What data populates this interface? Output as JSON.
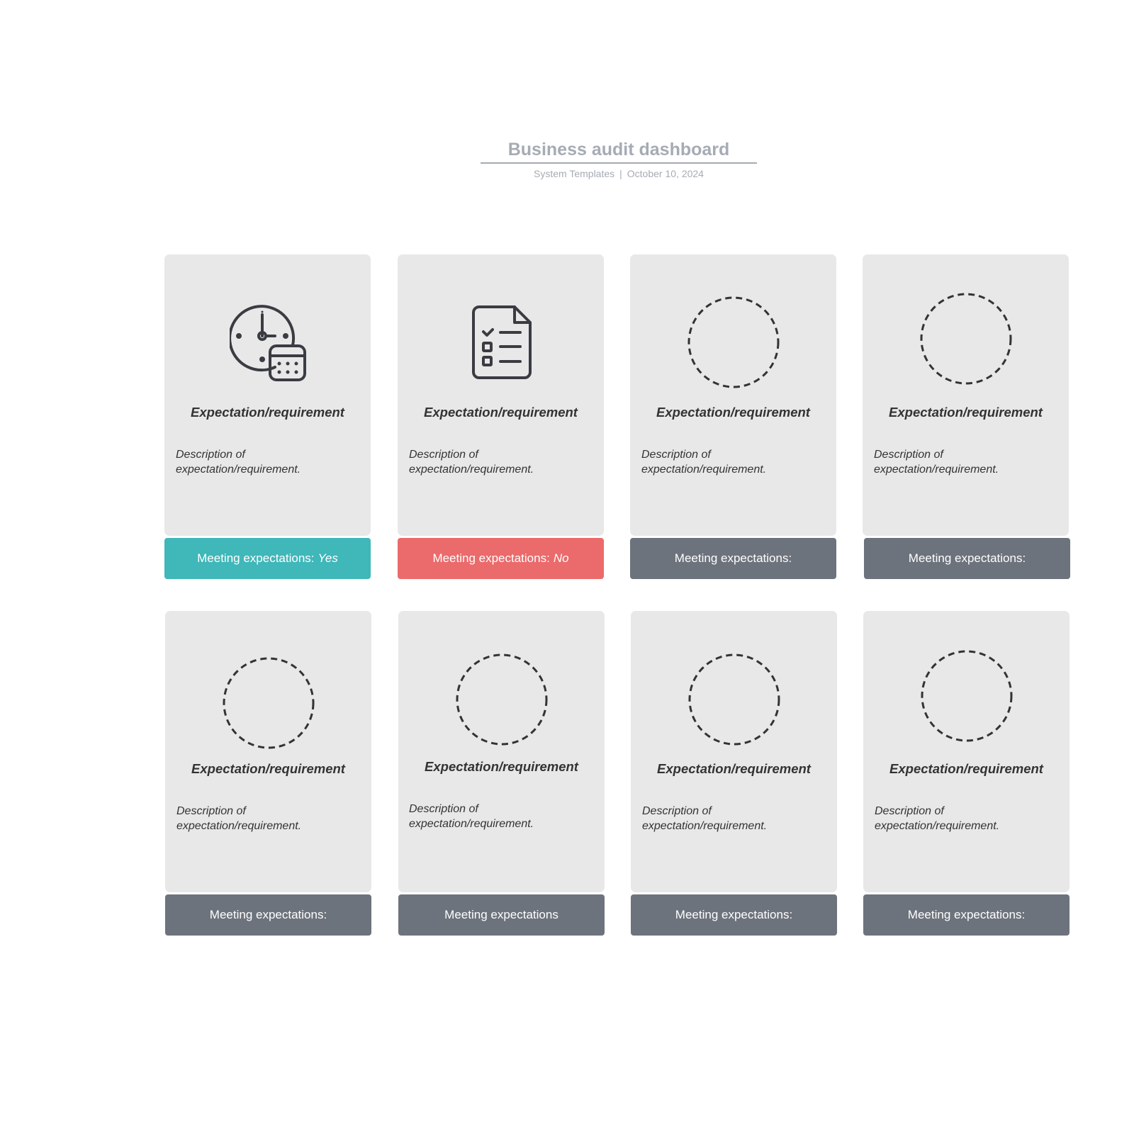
{
  "header": {
    "title": "Business audit dashboard",
    "author": "System Templates",
    "separator": "|",
    "date": "October 10, 2024"
  },
  "colors": {
    "yes": "#40b7b9",
    "no": "#eb6a6b",
    "empty": "#6d737c",
    "card_bg": "#e8e8e8"
  },
  "cards": [
    {
      "icon": "clock-calendar-icon",
      "title": "Expectation/requirement",
      "description": "Description of expectation/requirement.",
      "status_label": "Meeting expectations:",
      "status_value": "Yes",
      "status": "yes"
    },
    {
      "icon": "checklist-document-icon",
      "title": "Expectation/requirement",
      "description": "Description of expectation/requirement.",
      "status_label": "Meeting expectations:",
      "status_value": "No",
      "status": "no"
    },
    {
      "icon": "dashed-circle-placeholder-icon",
      "title": "Expectation/requirement",
      "description": "Description of expectation/requirement.",
      "status_label": "Meeting expectations:",
      "status_value": "",
      "status": "empty"
    },
    {
      "icon": "dashed-circle-placeholder-icon",
      "title": "Expectation/requirement",
      "description": "Description of expectation/requirement.",
      "status_label": "Meeting expectations:",
      "status_value": "",
      "status": "empty"
    },
    {
      "icon": "dashed-circle-placeholder-icon",
      "title": "Expectation/requirement",
      "description": "Description of expectation/requirement.",
      "status_label": "Meeting expectations:",
      "status_value": "",
      "status": "empty"
    },
    {
      "icon": "dashed-circle-placeholder-icon",
      "title": "Expectation/requirement",
      "description": "Description of expectation/requirement.",
      "status_label": "Meeting expectations",
      "status_value": "",
      "status": "empty"
    },
    {
      "icon": "dashed-circle-placeholder-icon",
      "title": "Expectation/requirement",
      "description": "Description of expectation/requirement.",
      "status_label": "Meeting expectations:",
      "status_value": "",
      "status": "empty"
    },
    {
      "icon": "dashed-circle-placeholder-icon",
      "title": "Expectation/requirement",
      "description": "Description of expectation/requirement.",
      "status_label": "Meeting expectations:",
      "status_value": "",
      "status": "empty"
    }
  ]
}
